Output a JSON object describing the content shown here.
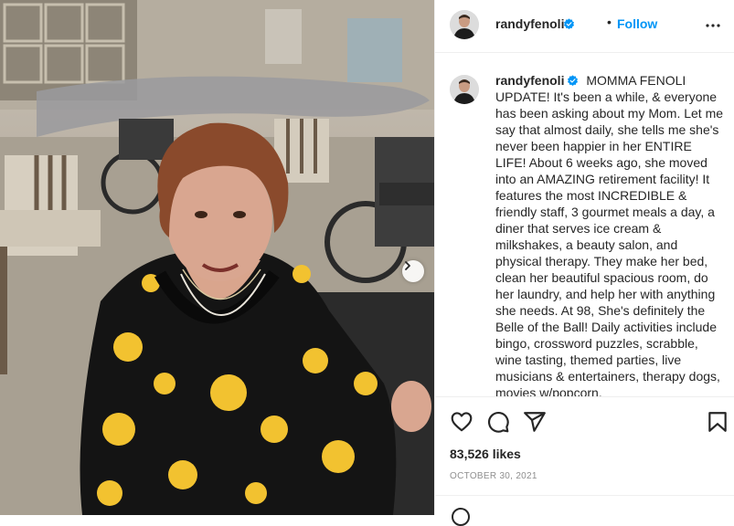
{
  "post": {
    "username": "randyfenoli",
    "follow_label": "Follow",
    "separator": "•",
    "caption": "MOMMA FENOLI UPDATE! It's been a while, & everyone has been asking about my Mom. Let me say that almost daily, she tells me she's never been happier in her ENTIRE LIFE! About 6 weeks ago, she moved into an AMAZING retirement facility! It features the most INCREDIBLE & friendly staff, 3 gourmet meals a day, a diner that serves ice cream & milkshakes, a beauty salon, and physical therapy. They make her bed, clean her beautiful spacious room, do her laundry, and help her with anything she needs. At 98, She's definitely the Belle of the Ball! Daily activities include bingo, crossword puzzles, scrabble, wine tasting, themed parties, live musicians & entertainers, therapy dogs, movies w/popcorn,",
    "likes": "83,526 likes",
    "date": "OCTOBER 30, 2021"
  },
  "colors": {
    "follow": "#0095f6",
    "verified": "#0095f6",
    "text": "#262626",
    "muted": "#8e8e8e"
  },
  "icons": [
    "verified-badge-icon",
    "more-options-icon",
    "heart-icon",
    "comment-icon",
    "share-icon",
    "bookmark-icon",
    "chevron-right-icon"
  ]
}
